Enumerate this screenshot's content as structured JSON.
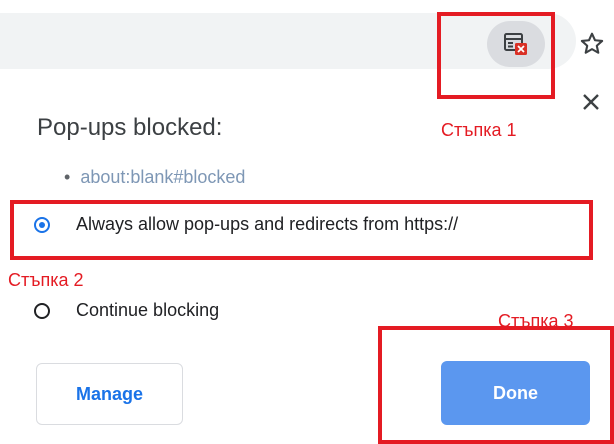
{
  "toolbar": {
    "popup_blocked_icon": "popup-blocked-icon",
    "star_icon": "star-icon"
  },
  "dialog": {
    "title": "Pop-ups blocked:",
    "blocked_bullet": "•",
    "blocked_items": [
      "about:blank#blocked"
    ],
    "options": [
      {
        "label": "Always allow pop-ups and redirects from https://",
        "selected": true
      },
      {
        "label": "Continue blocking",
        "selected": false
      }
    ],
    "manage_label": "Manage",
    "done_label": "Done"
  },
  "annotations": {
    "step1": "Стъпка 1",
    "step2": "Стъпка 2",
    "step3": "Стъпка 3",
    "color": "#e41b23"
  },
  "colors": {
    "accent": "#1a73e8",
    "done_button": "#5b97ef",
    "link": "#7e97b5"
  }
}
